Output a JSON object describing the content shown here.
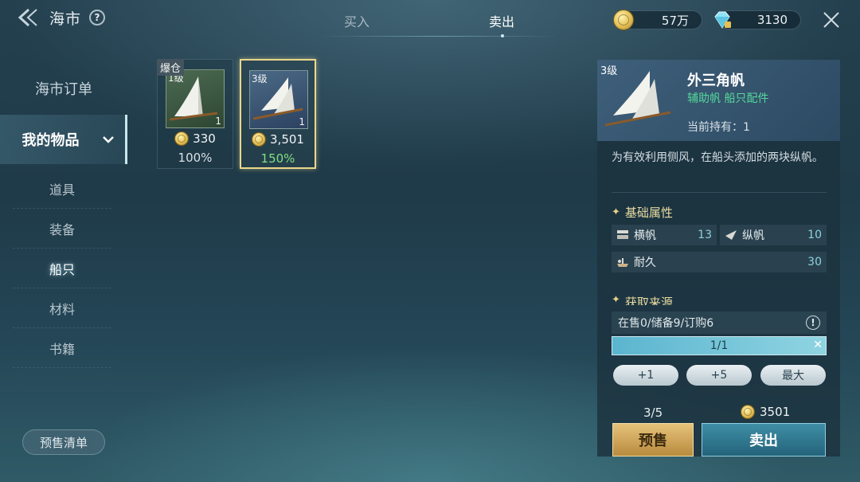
{
  "header": {
    "title": "海市",
    "help": "?",
    "tabs": {
      "buy": "买入",
      "sell": "卖出"
    },
    "currency": {
      "coins": "57万",
      "gems": "3130"
    }
  },
  "sidebar": {
    "orders": "海市订单",
    "my_items": "我的物品",
    "sub_items": [
      "道具",
      "装备",
      "船只",
      "材料",
      "书籍"
    ],
    "active_sub": "船只",
    "presale_list": "预售清单"
  },
  "items": [
    {
      "badge": "爆仓",
      "level": "1级",
      "qty": "1",
      "price": "330",
      "percent": "100%"
    },
    {
      "level": "3级",
      "qty": "1",
      "price": "3,501",
      "percent": "150%"
    }
  ],
  "detail": {
    "level": "3级",
    "name": "外三角帆",
    "type": "辅助帆  船只配件",
    "holding": "当前持有：1",
    "description": "为有效利用侧风，在船头添加的两块纵帆。",
    "section_basic": "基础属性",
    "attrs": {
      "square_sail": {
        "label": "横帆",
        "value": "13"
      },
      "fore_aft_sail": {
        "label": "纵帆",
        "value": "10"
      },
      "durability": {
        "label": "耐久",
        "value": "30"
      }
    },
    "section_source": "获取来源",
    "status": "在售0/储备9/订购6",
    "quantity": "1/1",
    "steps": [
      "+1",
      "+5",
      "最大"
    ],
    "count": "3/5",
    "total": "3501",
    "presale_button": "预售",
    "sell_button": "卖出"
  },
  "colors": {
    "accent_gold": "#e9d78a",
    "percent_green": "#7fe07f",
    "type_green": "#55d89a",
    "sell_button": "#2f7b92"
  }
}
